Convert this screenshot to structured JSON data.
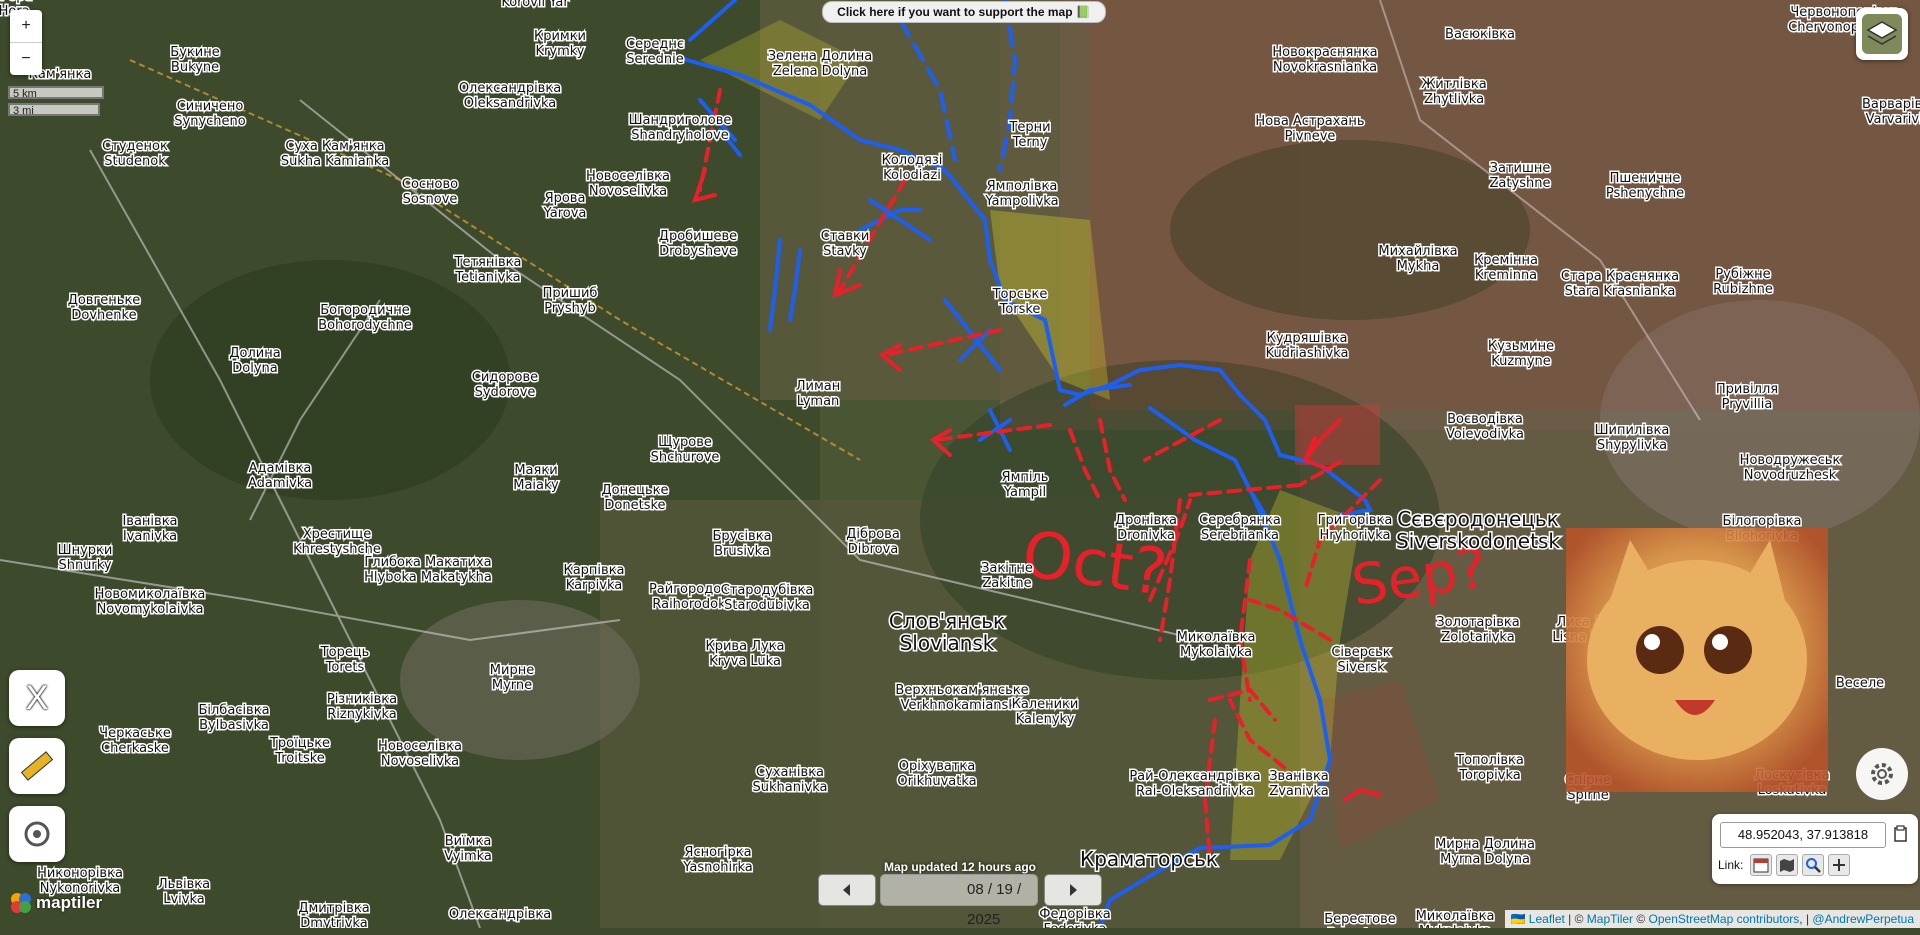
{
  "map": {
    "support_banner": "Click here if you want to support the map 📗",
    "zoom_in": "+",
    "zoom_out": "−",
    "scale_km": "5 km",
    "scale_mi": "3 mi",
    "updated": "Map updated 12 hours ago",
    "date": "08 / 19 / 2025",
    "coordinates": "48.952043, 37.913818",
    "link_label": "Link:",
    "attribution": {
      "flag": "🇺🇦",
      "leaflet": "Leaflet",
      "sep1": " | © ",
      "maptiler": "MapTiler",
      "sep2": " © ",
      "osm": "OpenStreetMap contributors",
      "sep3": ", | ",
      "author": "@AndrewPerpetua"
    },
    "maptiler_logo": "maptiler",
    "tools": {
      "close": "X"
    },
    "icons": [
      "layers-icon",
      "close-icon",
      "ruler-icon",
      "target-icon",
      "gear-icon",
      "copy-icon",
      "calendar-icon",
      "map-icon",
      "search-icon",
      "plus-icon",
      "chevron-left-icon",
      "chevron-right-icon"
    ],
    "colors": {
      "blue_line": "#1d5ff0",
      "red_arrow": "#e8202a",
      "yellow_zone": "#c9c22a",
      "red_zone": "#d2393a"
    },
    "annotations": [
      "Oct?",
      "Sep?"
    ],
    "labels": [
      {
        "uk": "Korovii Yar",
        "en": ""
      },
      {
        "uk": "Кримки",
        "en": "Krymky"
      },
      {
        "uk": "Букине",
        "en": "Bukyne"
      },
      {
        "uk": "Кам'янка",
        "en": ""
      },
      {
        "uk": "Олександрівка",
        "en": "Oleksandrivka"
      },
      {
        "uk": "Синичено",
        "en": "Synycheno"
      },
      {
        "uk": "Студенок",
        "en": "Studenok"
      },
      {
        "uk": "Суха Кам'янка",
        "en": "Sukha Kamianka"
      },
      {
        "uk": "Сосново",
        "en": "Sosnove"
      },
      {
        "uk": "Ярова",
        "en": "Yarova"
      },
      {
        "uk": "Середнє",
        "en": "Serednie"
      },
      {
        "uk": "Шандриголове",
        "en": "Shandryholove"
      },
      {
        "uk": "Новоселівка",
        "en": "Novoselivka"
      },
      {
        "uk": "Дробишеве",
        "en": "Drobysheve"
      },
      {
        "uk": "Зелена Долина",
        "en": "Zelena Dolyna"
      },
      {
        "uk": "Колодязі",
        "en": "Kolodiazi"
      },
      {
        "uk": "Ставки",
        "en": "Stavky"
      },
      {
        "uk": "Терни",
        "en": "Terny"
      },
      {
        "uk": "Ямполівка",
        "en": "Yampolivka"
      },
      {
        "uk": "Торське",
        "en": "Torske"
      },
      {
        "uk": "Тетянівка",
        "en": "Tetianivka"
      },
      {
        "uk": "Довгеньке",
        "en": "Dovhenke"
      },
      {
        "uk": "Богородичне",
        "en": "Bohorodychne"
      },
      {
        "uk": "Пришиб",
        "en": "Pryshyb"
      },
      {
        "uk": "Долина",
        "en": "Dolyna"
      },
      {
        "uk": "Сидорове",
        "en": "Sydorove"
      },
      {
        "uk": "Лиман",
        "en": "Lyman"
      },
      {
        "uk": "Щурове",
        "en": "Shchurove"
      },
      {
        "uk": "Адамівка",
        "en": "Adamivka"
      },
      {
        "uk": "Маяки",
        "en": "Maiaky"
      },
      {
        "uk": "Донецьке",
        "en": "Donetske"
      },
      {
        "uk": "Ямпіль",
        "en": "Yampil"
      },
      {
        "uk": "Дронівка",
        "en": "Dronivka"
      },
      {
        "uk": "Серебрянка",
        "en": "Serebrianka"
      },
      {
        "uk": "Григорівка",
        "en": "Hryhorivka"
      },
      {
        "uk": "Іванівка",
        "en": "Ivanivka"
      },
      {
        "uk": "Хрестище",
        "en": "Khrestyshche"
      },
      {
        "uk": "Шнурки",
        "en": "Shnurky"
      },
      {
        "uk": "Глибока Макатиха",
        "en": "Hlyboka Makatykha"
      },
      {
        "uk": "Карпівка",
        "en": "Karpivka"
      },
      {
        "uk": "Брусівка",
        "en": "Brusivka"
      },
      {
        "uk": "Діброва",
        "en": "Dibrova"
      },
      {
        "uk": "Закітне",
        "en": "Zakitne"
      },
      {
        "uk": "Райгородок",
        "en": "Raihorodok"
      },
      {
        "uk": "Стародубівка",
        "en": "Starodubivka"
      },
      {
        "uk": "Новомиколаївка",
        "en": "Novomykolaivka"
      },
      {
        "uk": "Торець",
        "en": "Torets"
      },
      {
        "uk": "Мирне",
        "en": "Myrne"
      },
      {
        "uk": "Слов'янськ",
        "en": "Sloviansk"
      },
      {
        "uk": "Кривa Лука",
        "en": "Kryva Luka"
      },
      {
        "uk": "Миколаївка",
        "en": "Mykolaivka"
      },
      {
        "uk": "Сіверськ",
        "en": "Siversk"
      },
      {
        "uk": "Верхньокам'янське",
        "en": "Verkhnokamianske"
      },
      {
        "uk": "Каленики",
        "en": "Kalenyky"
      },
      {
        "uk": "Різниківка",
        "en": "Riznykivka"
      },
      {
        "uk": "Білбасівка",
        "en": "Bylbasivka"
      },
      {
        "uk": "Черкаське",
        "en": "Cherkaske"
      },
      {
        "uk": "Троїцьке",
        "en": "Troitske"
      },
      {
        "uk": "Новоселівка",
        "en": "Novoselivka"
      },
      {
        "uk": "Суханівка",
        "en": "Sukhanivka"
      },
      {
        "uk": "Оріхуватка",
        "en": "Orikhuvatka"
      },
      {
        "uk": "Рай-Олександрівка",
        "en": "Rai-Oleksandrivka"
      },
      {
        "uk": "Званівка",
        "en": "Zvanivka"
      },
      {
        "uk": "Виїмка",
        "en": "Vyimka"
      },
      {
        "uk": "Ясногірка",
        "en": "Yasnohirka"
      },
      {
        "uk": "Никонорівка",
        "en": "Nykonorivka"
      },
      {
        "uk": "Львівка",
        "en": "Lvivka"
      },
      {
        "uk": "Дмитрівка",
        "en": "Dmytrivka"
      },
      {
        "uk": "Олександрівка",
        "en": ""
      },
      {
        "uk": "Краматорськ",
        "en": ""
      },
      {
        "uk": "Федорівка",
        "en": "Fedorivka"
      },
      {
        "uk": "Васюківка",
        "en": ""
      },
      {
        "uk": "Новокраснянка",
        "en": "Novokrasnianka"
      },
      {
        "uk": "Червонопопівка",
        "en": "Chervonopopivka"
      },
      {
        "uk": "Нова Астрахань",
        "en": "Pivneve"
      },
      {
        "uk": "Житлівка",
        "en": "Zhytlivka"
      },
      {
        "uk": "Затишне",
        "en": "Zatyshne"
      },
      {
        "uk": "Пшеничне",
        "en": "Pshenychne"
      },
      {
        "uk": "Варварівка",
        "en": "Varvarivka"
      },
      {
        "uk": "Михайлівка",
        "en": "Mykha"
      },
      {
        "uk": "Кремінна",
        "en": "Kreminna"
      },
      {
        "uk": "Стара Краснянка",
        "en": "Stara Krasnianka"
      },
      {
        "uk": "Рубіжне",
        "en": "Rubizhne"
      },
      {
        "uk": "Кудряшівка",
        "en": "Kudriashivka"
      },
      {
        "uk": "Кузьмине",
        "en": "Kuzmyne"
      },
      {
        "uk": "Привілля",
        "en": "Pryvillia"
      },
      {
        "uk": "Воєводівка",
        "en": "Voievodivka"
      },
      {
        "uk": "Шипилівка",
        "en": "Shypylivka"
      },
      {
        "uk": "Новодружеськ",
        "en": "Novodruzhesk"
      },
      {
        "uk": "Сєвєродонецьк",
        "en": "Siverskodonetsk"
      },
      {
        "uk": "Білогорівка",
        "en": "Bilohorivka"
      },
      {
        "uk": "Золотарівка",
        "en": "Zolotarivka"
      },
      {
        "uk": "Лиса Дача",
        "en": "Lisna Dacha"
      },
      {
        "uk": "Тополівка",
        "en": "Toropivka"
      },
      {
        "uk": "Спірне",
        "en": "Spirne"
      },
      {
        "uk": "Лоскутівка",
        "en": "Loskutivka"
      },
      {
        "uk": "Мирна Долина",
        "en": "Myrna Dolyna"
      },
      {
        "uk": "Миколаївка",
        "en": "Mykolaivka"
      },
      {
        "uk": "Берестове",
        "en": "Berestove"
      },
      {
        "uk": "Веселе",
        "en": ""
      },
      {
        "uk": "Біла Гора",
        "en": "Bila Hora"
      }
    ]
  }
}
